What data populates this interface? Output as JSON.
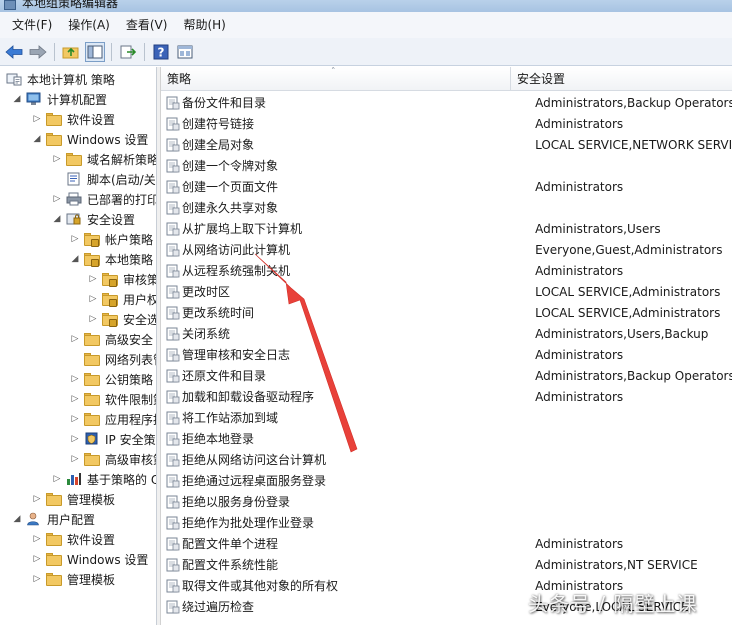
{
  "window": {
    "title": "本地组策略编辑器"
  },
  "menu": [
    "文件(F)",
    "操作(A)",
    "查看(V)",
    "帮助(H)"
  ],
  "toolbar": [
    "back-arrow-icon",
    "forward-arrow-icon",
    "up-folder-icon",
    "show-tree-icon",
    "export-list-icon",
    "help-icon",
    "properties-icon"
  ],
  "tree": [
    {
      "label": "本地计算机 策略",
      "indent": 0,
      "icon": "policy-computer-icon",
      "toggle": ""
    },
    {
      "label": "计算机配置",
      "indent": 1,
      "icon": "computer-icon",
      "toggle": "open"
    },
    {
      "label": "软件设置",
      "indent": 2,
      "icon": "folder-icon",
      "toggle": "closed"
    },
    {
      "label": "Windows 设置",
      "indent": 2,
      "icon": "folder-icon",
      "toggle": "open"
    },
    {
      "label": "域名解析策略",
      "indent": 3,
      "icon": "folder-icon",
      "toggle": "closed"
    },
    {
      "label": "脚本(启动/关机)",
      "indent": 3,
      "icon": "script-icon",
      "toggle": ""
    },
    {
      "label": "已部署的打印机",
      "indent": 3,
      "icon": "printer-icon",
      "toggle": "closed"
    },
    {
      "label": "安全设置",
      "indent": 3,
      "icon": "security-icon",
      "toggle": "open"
    },
    {
      "label": "帐户策略",
      "indent": 4,
      "icon": "lock-folder-icon",
      "toggle": "closed"
    },
    {
      "label": "本地策略",
      "indent": 4,
      "icon": "lock-folder-icon",
      "toggle": "open"
    },
    {
      "label": "审核策略",
      "indent": 5,
      "icon": "lock-folder-icon",
      "toggle": "closed"
    },
    {
      "label": "用户权限分配",
      "indent": 5,
      "icon": "lock-folder-icon",
      "toggle": "closed"
    },
    {
      "label": "安全选项",
      "indent": 5,
      "icon": "lock-folder-icon",
      "toggle": "closed"
    },
    {
      "label": "高级安全 Windows 防火墙",
      "indent": 4,
      "icon": "folder-icon",
      "toggle": "closed"
    },
    {
      "label": "网络列表管理器策略",
      "indent": 4,
      "icon": "folder-icon",
      "toggle": ""
    },
    {
      "label": "公钥策略",
      "indent": 4,
      "icon": "folder-icon",
      "toggle": "closed"
    },
    {
      "label": "软件限制策略",
      "indent": 4,
      "icon": "folder-icon",
      "toggle": "closed"
    },
    {
      "label": "应用程序控制策略",
      "indent": 4,
      "icon": "folder-icon",
      "toggle": "closed"
    },
    {
      "label": "IP 安全策略",
      "indent": 4,
      "icon": "ip-security-icon",
      "toggle": "closed"
    },
    {
      "label": "高级审核策略配置",
      "indent": 4,
      "icon": "folder-icon",
      "toggle": "closed"
    },
    {
      "label": "基于策略的 QoS",
      "indent": 3,
      "icon": "chart-icon",
      "toggle": "closed"
    },
    {
      "label": "管理模板",
      "indent": 2,
      "icon": "folder-icon",
      "toggle": "closed"
    },
    {
      "label": "用户配置",
      "indent": 1,
      "icon": "user-icon",
      "toggle": "open"
    },
    {
      "label": "软件设置",
      "indent": 2,
      "icon": "folder-icon",
      "toggle": "closed"
    },
    {
      "label": "Windows 设置",
      "indent": 2,
      "icon": "folder-icon",
      "toggle": "closed"
    },
    {
      "label": "管理模板",
      "indent": 2,
      "icon": "folder-icon",
      "toggle": "closed"
    }
  ],
  "columns": {
    "policy": "策略",
    "setting": "安全设置"
  },
  "rows": [
    {
      "policy": "备份文件和目录",
      "setting": "Administrators,Backup Operators"
    },
    {
      "policy": "创建符号链接",
      "setting": "Administrators"
    },
    {
      "policy": "创建全局对象",
      "setting": "LOCAL SERVICE,NETWORK SERVICE"
    },
    {
      "policy": "创建一个令牌对象",
      "setting": ""
    },
    {
      "policy": "创建一个页面文件",
      "setting": "Administrators"
    },
    {
      "policy": "创建永久共享对象",
      "setting": ""
    },
    {
      "policy": "从扩展坞上取下计算机",
      "setting": "Administrators,Users"
    },
    {
      "policy": "从网络访问此计算机",
      "setting": "Everyone,Guest,Administrators"
    },
    {
      "policy": "从远程系统强制关机",
      "setting": "Administrators"
    },
    {
      "policy": "更改时区",
      "setting": "LOCAL SERVICE,Administrators"
    },
    {
      "policy": "更改系统时间",
      "setting": "LOCAL SERVICE,Administrators"
    },
    {
      "policy": "关闭系统",
      "setting": "Administrators,Users,Backup"
    },
    {
      "policy": "管理审核和安全日志",
      "setting": "Administrators"
    },
    {
      "policy": "还原文件和目录",
      "setting": "Administrators,Backup Operators"
    },
    {
      "policy": "加载和卸载设备驱动程序",
      "setting": "Administrators"
    },
    {
      "policy": "将工作站添加到域",
      "setting": ""
    },
    {
      "policy": "拒绝本地登录",
      "setting": ""
    },
    {
      "policy": "拒绝从网络访问这台计算机",
      "setting": ""
    },
    {
      "policy": "拒绝通过远程桌面服务登录",
      "setting": ""
    },
    {
      "policy": "拒绝以服务身份登录",
      "setting": ""
    },
    {
      "policy": "拒绝作为批处理作业登录",
      "setting": ""
    },
    {
      "policy": "配置文件单个进程",
      "setting": "Administrators"
    },
    {
      "policy": "配置文件系统性能",
      "setting": "Administrators,NT SERVICE"
    },
    {
      "policy": "取得文件或其他对象的所有权",
      "setting": "Administrators"
    },
    {
      "policy": "绕过遍历检查",
      "setting": "Everyone,LOCAL SERVICE"
    }
  ],
  "watermark": "头条号 / 隔壁上课",
  "colors": {
    "annotation_arrow": "#e8413a",
    "folder": "#f2c862",
    "header_bg": "#f1f3f6"
  }
}
